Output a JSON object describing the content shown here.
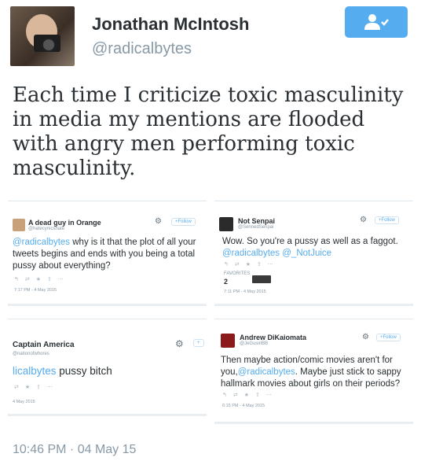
{
  "author": {
    "name": "Jonathan McIntosh",
    "handle": "@radicalbytes"
  },
  "tweet": {
    "text": "Each time I criticize toxic masculinity in media my mentions are flooded with angry men performing toxic masculinity.",
    "timestamp": "10:46 PM · 04 May 15"
  },
  "colors": {
    "accent": "#55acee",
    "muted": "#8899a6",
    "text": "#292f33"
  },
  "icons": {
    "follow": "add-user-icon",
    "gear": "gear-icon"
  },
  "embedded_tweets": [
    {
      "name": "A dead guy in Orange",
      "handle": "@hatecynicshate",
      "follow_label": "Follow",
      "mention": "@radicalbytes",
      "body": " why is it that the plot of all your tweets begins and ends with you being a total pussy about everything?",
      "time": "7:17 PM - 4 May 2015"
    },
    {
      "name": "Not Senpai",
      "handle": "@SennedSenpai",
      "follow_label": "Follow",
      "line1": "Wow. So you're a pussy as well as a faggot.",
      "mention1": "@radicalbytes",
      "mention2": "@_NotJuice",
      "favorites_label": "FAVORITES",
      "favorites_count": "2",
      "time": "7:11 PM - 4 May 2015"
    },
    {
      "name": "Captain America",
      "handle": "@nationofwhores",
      "mention": "licalbytes",
      "body": " pussy bitch",
      "time": "4 May 2015"
    },
    {
      "name": "Andrew DiKaiomata",
      "handle": "@JeGusiriBB",
      "follow_label": "Follow",
      "body_a": "Then maybe action/comic movies aren't for you,",
      "mention": "@radicalbytes",
      "body_b": ". Maybe just stick to sappy hallmark movies about girls on their periods?",
      "time": "6:15 PM - 4 May 2015"
    }
  ]
}
